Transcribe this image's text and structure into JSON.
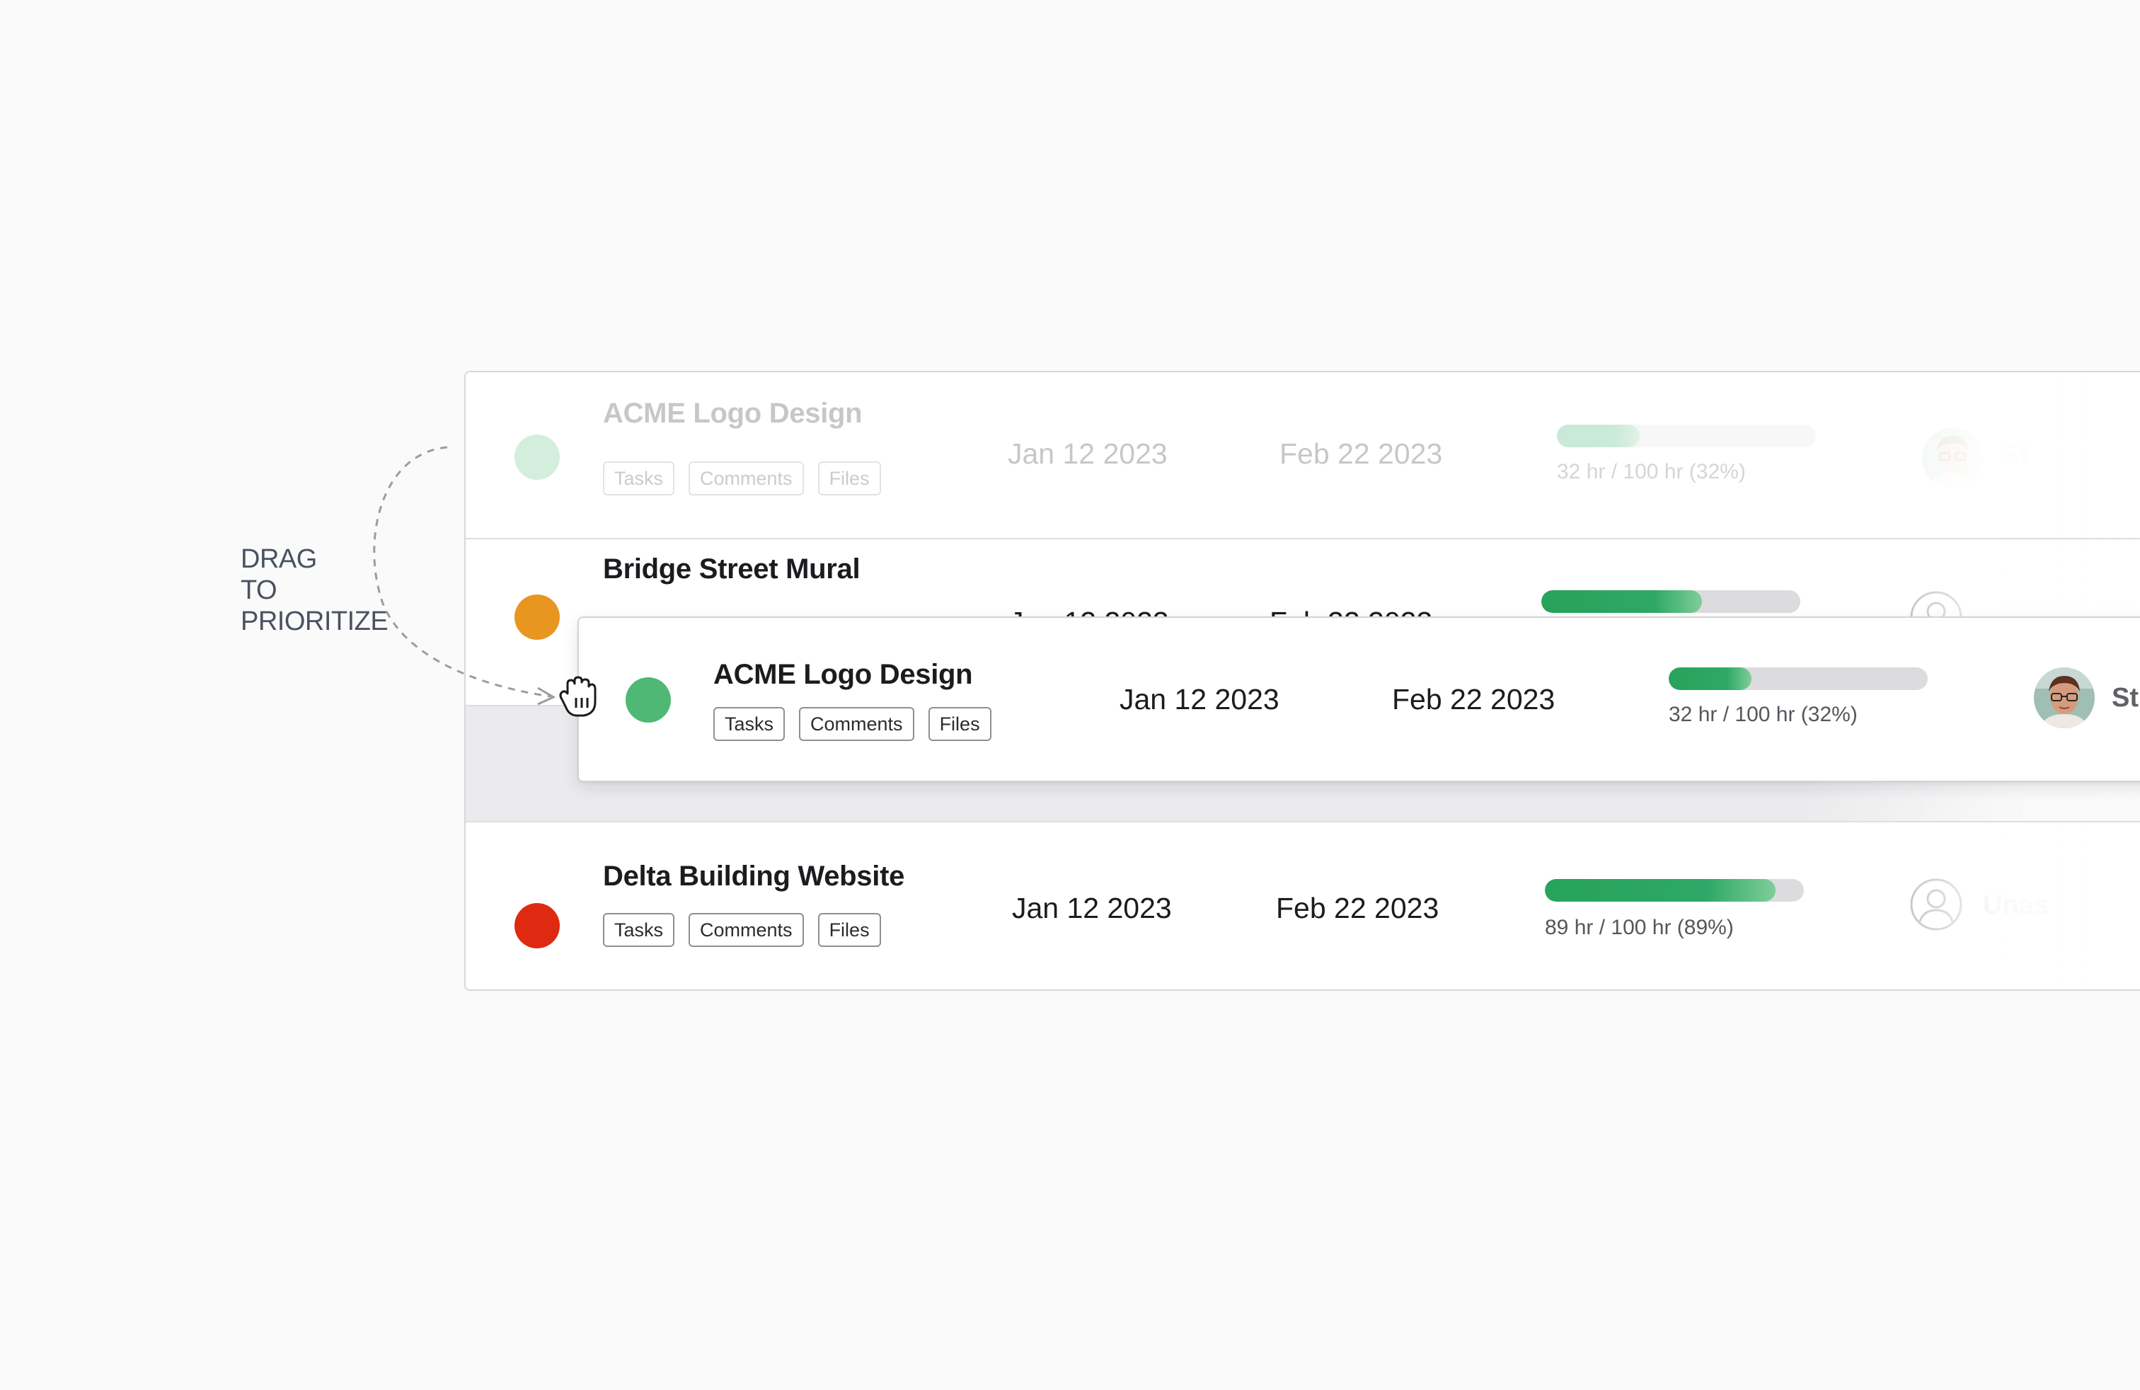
{
  "annotation": {
    "line1": "DRAG",
    "line2": "TO",
    "line3": "PRIORITIZE"
  },
  "colors": {
    "green": "#4fb874",
    "orange": "#e8961f",
    "red": "#dd2a10",
    "progress": "#27a35c"
  },
  "chip_labels": {
    "tasks": "Tasks",
    "comments": "Comments",
    "files": "Files"
  },
  "rows": {
    "acme_placeholder": {
      "name": "ACME Logo Design",
      "start": "Jan 12 2023",
      "end": "Feb 22 2023",
      "hours": "32 hr / 100 hr (32%)",
      "progress": 0.32,
      "assignee": "St"
    },
    "bridge": {
      "name": "Bridge Street Mural",
      "start": "Jan 12 2023",
      "end": "Feb 22 2023",
      "progress": 0.62
    },
    "acme_dragged": {
      "name": "ACME Logo Design",
      "start": "Jan 12 2023",
      "end": "Feb 22 2023",
      "hours": "32 hr / 100 hr (32%)",
      "progress": 0.32,
      "assignee": "St"
    },
    "delta": {
      "name": "Delta Building Website",
      "start": "Jan 12 2023",
      "end": "Feb 22 2023",
      "hours": "89 hr / 100 hr (89%)",
      "progress": 0.89,
      "assignee": "Unas"
    }
  },
  "icons": [
    "drag-hand-icon",
    "user-circle-icon",
    "avatar-photo"
  ]
}
